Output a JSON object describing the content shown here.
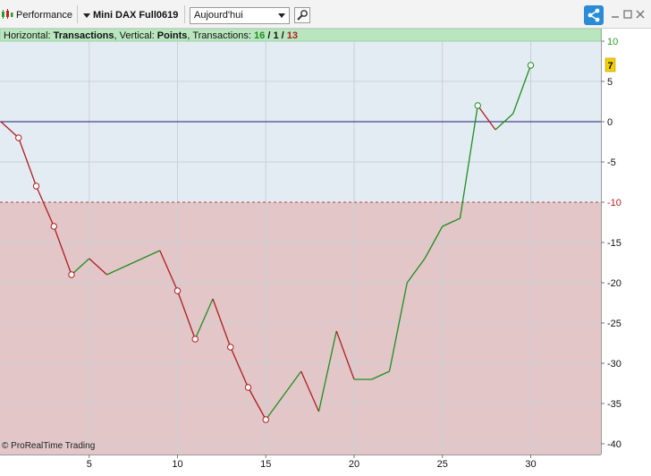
{
  "toolbar": {
    "performance_label": "Performance",
    "instrument_label": "Mini DAX Full0619",
    "period_value": "Aujourd'hui"
  },
  "info_bar": {
    "horizontal_label": "Horizontal: ",
    "horizontal_value": "Transactions",
    "vertical_label": ", Vertical: ",
    "vertical_value": "Points",
    "transactions_label": ", Transactions: ",
    "winning_count": "16",
    "separator_1": " / ",
    "neutral_count": "1",
    "separator_2": " / ",
    "losing_count": "13"
  },
  "watermark": "© ProRealTime Trading",
  "colors": {
    "win": "#1e8f1e",
    "loss": "#b01e1e",
    "zero_line": "#1a1a7a",
    "loss_zone": "#e2c6c8",
    "neutral_zone": "#e4ecf3",
    "win_band": "#b9e6bf",
    "current_badge": "#f2d000"
  },
  "chart_data": {
    "type": "line",
    "title": "",
    "xlabel": "Transactions",
    "ylabel": "Points",
    "xlim": [
      0,
      34
    ],
    "ylim": [
      -41,
      11
    ],
    "x_ticks": [
      5,
      10,
      15,
      20,
      25,
      30
    ],
    "y_ticks": [
      10,
      5,
      0,
      -5,
      -10,
      -15,
      -20,
      -25,
      -30,
      -35,
      -40
    ],
    "win_threshold": 10,
    "loss_threshold": -10,
    "current_value": 7,
    "x": [
      0,
      1,
      2,
      3,
      4,
      5,
      6,
      7,
      8,
      9,
      10,
      11,
      12,
      13,
      14,
      15,
      16,
      17,
      18,
      19,
      20,
      21,
      22,
      23,
      24,
      25,
      26,
      27,
      28,
      29,
      30
    ],
    "y": [
      0,
      -2,
      -8,
      -13,
      -19,
      -17,
      -19,
      -18,
      -17,
      -16,
      -21,
      -27,
      -22,
      -28,
      -33,
      -37,
      -34,
      -31,
      -36,
      -26,
      -32,
      -32,
      -31,
      -20,
      -17,
      -13,
      -12,
      2,
      -1,
      1,
      7
    ],
    "marked_points": [
      1,
      2,
      3,
      4,
      10,
      11,
      13,
      14,
      15,
      27,
      30
    ],
    "grid": true
  }
}
